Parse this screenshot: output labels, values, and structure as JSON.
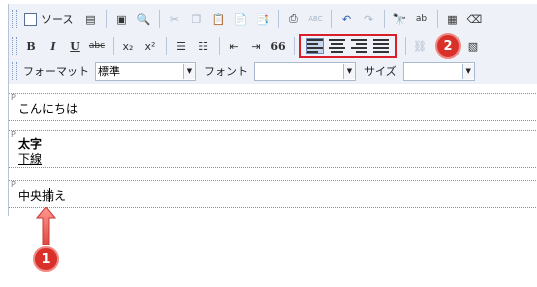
{
  "toolbar": {
    "row1": {
      "source_label": "ソース",
      "spell_label": "ABC",
      "find_label": "ab"
    },
    "row2": {
      "bold": "B",
      "italic": "I",
      "underline": "U",
      "strike": "abc",
      "subscript": "x₂",
      "superscript": "x²",
      "quote": "66"
    },
    "row3": {
      "format_label": "フォーマット",
      "format_value": "標準",
      "font_label": "フォント",
      "font_value": "",
      "size_label": "サイズ",
      "size_value": ""
    }
  },
  "content": {
    "paragraphs": [
      {
        "marker": "P",
        "lines": [
          "こんにちは"
        ]
      },
      {
        "marker": "P",
        "lines": [
          "太字",
          "下線"
        ]
      },
      {
        "marker": "P",
        "lines": [
          "中央揃え"
        ]
      }
    ]
  },
  "annotations": {
    "badge_1": "1",
    "badge_2": "2",
    "accent_color": "#d9302a",
    "highlight_color": "#d9202a"
  }
}
